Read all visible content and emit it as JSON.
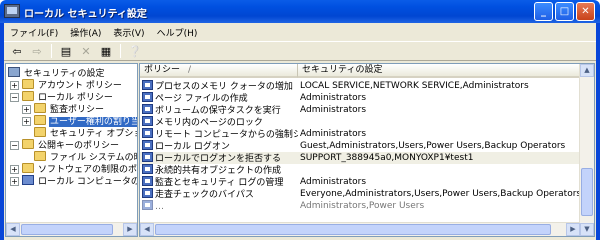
{
  "window": {
    "title": "ローカル セキュリティ設定"
  },
  "menu": [
    "ファイル(F)",
    "操作(A)",
    "表示(V)",
    "ヘルプ(H)"
  ],
  "toolbar": {
    "buttons": [
      {
        "icon": "back-arrow-icon",
        "glyph": "⇦"
      },
      {
        "icon": "forward-arrow-icon",
        "glyph": "⇨"
      },
      {
        "icon": "up-folder-icon",
        "glyph": "▤"
      },
      {
        "icon": "delete-icon",
        "glyph": "✕"
      },
      {
        "icon": "properties-icon",
        "glyph": "▦"
      },
      {
        "icon": "help-icon",
        "glyph": "❔"
      }
    ]
  },
  "tree": {
    "items": [
      {
        "label": "セキュリティの設定",
        "icon": "computer"
      },
      {
        "label": "アカウント ポリシー",
        "icon": "folder",
        "expander": "+"
      },
      {
        "label": "ローカル ポリシー",
        "icon": "folder",
        "expander": "−"
      },
      {
        "label": "監査ポリシー",
        "icon": "folder",
        "expander": "+"
      },
      {
        "label": "ユーザー権利の割り当て",
        "icon": "folder",
        "expander": "+",
        "selected": true
      },
      {
        "label": "セキュリティ オプション",
        "icon": "folder"
      },
      {
        "label": "公開キーのポリシー",
        "icon": "folder",
        "expander": "−"
      },
      {
        "label": "ファイル システムの暗号化",
        "icon": "folder"
      },
      {
        "label": "ソフトウェアの制限のポリシー",
        "icon": "folder",
        "expander": "+"
      },
      {
        "label": "ローカル コンピュータの IP セキュリティ",
        "icon": "policy",
        "expander": "+"
      }
    ]
  },
  "list": {
    "columns": [
      "ポリシー",
      "セキュリティの設定"
    ],
    "sort_indicator": "/",
    "rows": [
      {
        "policy": "プロセスのメモリ クォータの増加",
        "setting": "LOCAL SERVICE,NETWORK SERVICE,Administrators"
      },
      {
        "policy": "ページ ファイルの作成",
        "setting": "Administrators"
      },
      {
        "policy": "ボリュームの保守タスクを実行",
        "setting": "Administrators"
      },
      {
        "policy": "メモリ内のページのロック",
        "setting": ""
      },
      {
        "policy": "リモート コンピュータからの強制シャッ...",
        "setting": "Administrators"
      },
      {
        "policy": "ローカル ログオン",
        "setting": "Guest,Administrators,Users,Power Users,Backup Operators"
      },
      {
        "policy": "ローカルでログオンを拒否する",
        "setting": "SUPPORT_388945a0,MONYOXP1¥test1"
      },
      {
        "policy": "永続的共有オブジェクトの作成",
        "setting": ""
      },
      {
        "policy": "監査とセキュリティ ログの管理",
        "setting": "Administrators"
      },
      {
        "policy": "走査チェックのバイパス",
        "setting": "Everyone,Administrators,Users,Power Users,Backup Operators"
      },
      {
        "policy": "…",
        "setting": "Administrators,Power Users"
      }
    ],
    "highlighted_row": 6
  }
}
